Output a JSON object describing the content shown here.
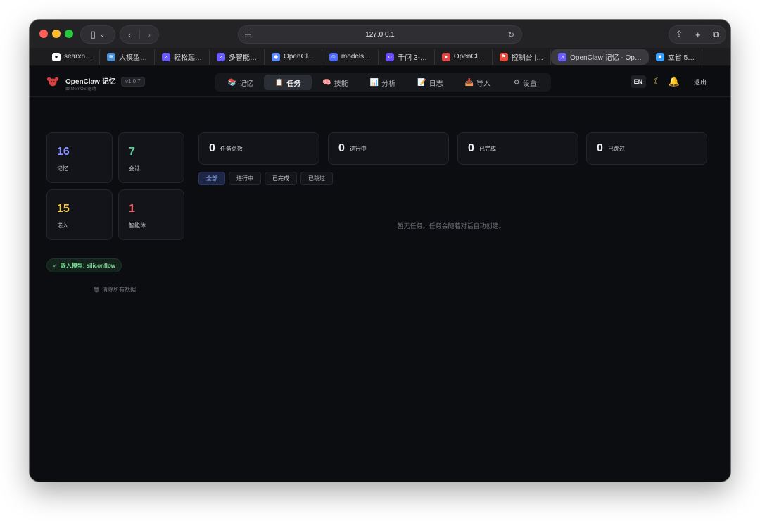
{
  "browser": {
    "url": "127.0.0.1",
    "tabs": [
      {
        "label": "searxn…",
        "icon": "github-icon",
        "color": "#ffffff"
      },
      {
        "label": "大模型…",
        "icon": "layers-icon",
        "color": "#4a90d9"
      },
      {
        "label": "轻松起…",
        "icon": "mountain-icon",
        "color": "#6b5cff"
      },
      {
        "label": "多智能…",
        "icon": "mountain-icon",
        "color": "#6b5cff"
      },
      {
        "label": "OpenCl…",
        "icon": "claw-icon",
        "color": "#5b8cff"
      },
      {
        "label": "models…",
        "icon": "hf-icon",
        "color": "#4f6bff"
      },
      {
        "label": "千问 3-…",
        "icon": "code-icon",
        "color": "#6c4cff"
      },
      {
        "label": "OpenCl…",
        "icon": "lobster-icon",
        "color": "#e04848"
      },
      {
        "label": "控制台 |…",
        "icon": "map-pin-icon",
        "color": "#e84b3c"
      },
      {
        "label": "OpenClaw 记忆 - Op…",
        "icon": "mountain-icon",
        "color": "#6b5cff"
      },
      {
        "label": "立省 5…",
        "icon": "square-icon",
        "color": "#3aa0ff"
      }
    ],
    "active_tab": 9
  },
  "header": {
    "brand_title": "OpenClaw 记忆",
    "brand_sub": "由 MemOS 驱动",
    "version": "v1.0.7",
    "lang": "EN",
    "logout": "退出"
  },
  "nav": [
    {
      "label": "记忆",
      "icon": "📚"
    },
    {
      "label": "任务",
      "icon": "📋"
    },
    {
      "label": "技能",
      "icon": "🧠"
    },
    {
      "label": "分析",
      "icon": "📊"
    },
    {
      "label": "日志",
      "icon": "📝"
    },
    {
      "label": "导入",
      "icon": "📥"
    },
    {
      "label": "设置",
      "icon": "⚙"
    }
  ],
  "stats": [
    {
      "value": "16",
      "label": "记忆",
      "color": "#8b93ff"
    },
    {
      "value": "7",
      "label": "会话",
      "color": "#5fd39a"
    },
    {
      "value": "15",
      "label": "嵌入",
      "color": "#f2c94c"
    },
    {
      "value": "1",
      "label": "智能体",
      "color": "#f06060"
    }
  ],
  "embed_badge": "嵌入模型: siliconflow",
  "clear_data": "清除所有数据",
  "summary": [
    {
      "value": "0",
      "label": "任务总数"
    },
    {
      "value": "0",
      "label": "进行中"
    },
    {
      "value": "0",
      "label": "已完成"
    },
    {
      "value": "0",
      "label": "已跳过"
    }
  ],
  "filters": [
    "全部",
    "进行中",
    "已完成",
    "已跳过"
  ],
  "empty_message": "暂无任务。任务会随着对话自动创建。"
}
